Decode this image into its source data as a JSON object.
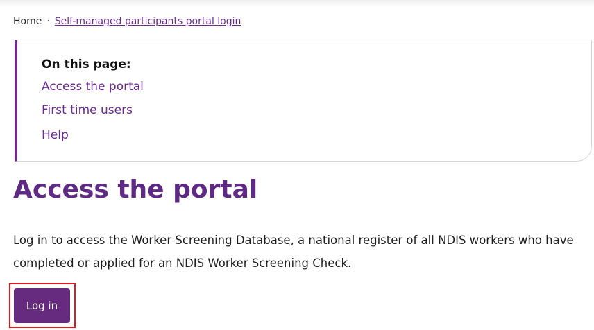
{
  "breadcrumb": {
    "home": "Home",
    "separator": "·",
    "current": "Self-managed participants portal login"
  },
  "on_this_page": {
    "title": "On this page:",
    "links": [
      {
        "label": "Access the portal"
      },
      {
        "label": "First time users"
      },
      {
        "label": "Help"
      }
    ]
  },
  "main": {
    "heading": "Access the portal",
    "description": "Log in to access the Worker Screening Database, a national register of all NDIS workers who have completed or applied for an NDIS Worker Screening Check.",
    "login_label": "Log in"
  },
  "colors": {
    "accent": "#6b2c8f",
    "button": "#662a7f",
    "highlight": "#e0191f"
  }
}
